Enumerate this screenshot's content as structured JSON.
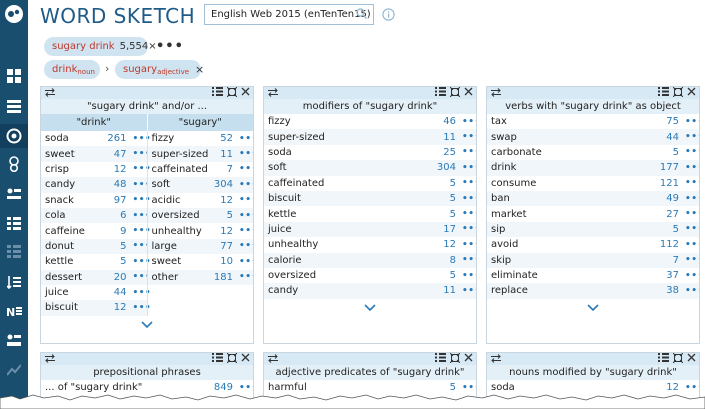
{
  "app": {
    "title": "WORD SKETCH"
  },
  "corpus": {
    "value": "English Web 2015 (enTenTen15)"
  },
  "query": {
    "text": "sugary drink",
    "count": "5,554×",
    "more": "•••"
  },
  "breadcrumb": {
    "lemma1": "drink",
    "pos1": "noun",
    "sep": "›",
    "lemma2": "sugary",
    "pos2": "adjective",
    "close": "×"
  },
  "panels": {
    "andor": {
      "title": "\"sugary drink\" and/or ...",
      "col1": "\"drink\"",
      "col2": "\"sugary\"",
      "left": [
        {
          "w": "soda",
          "n": "261"
        },
        {
          "w": "sweet",
          "n": "47"
        },
        {
          "w": "crisp",
          "n": "12"
        },
        {
          "w": "candy",
          "n": "48"
        },
        {
          "w": "snack",
          "n": "97"
        },
        {
          "w": "cola",
          "n": "6"
        },
        {
          "w": "caffeine",
          "n": "9"
        },
        {
          "w": "donut",
          "n": "5"
        },
        {
          "w": "kettle",
          "n": "5"
        },
        {
          "w": "dessert",
          "n": "20"
        },
        {
          "w": "juice",
          "n": "44"
        },
        {
          "w": "biscuit",
          "n": "12"
        }
      ],
      "right": [
        {
          "w": "fizzy",
          "n": "52"
        },
        {
          "w": "super-sized",
          "n": "11"
        },
        {
          "w": "caffeinated",
          "n": "7"
        },
        {
          "w": "soft",
          "n": "304"
        },
        {
          "w": "acidic",
          "n": "12"
        },
        {
          "w": "oversized",
          "n": "5"
        },
        {
          "w": "unhealthy",
          "n": "12"
        },
        {
          "w": "large",
          "n": "77"
        },
        {
          "w": "sweet",
          "n": "10"
        },
        {
          "w": "other",
          "n": "181"
        }
      ]
    },
    "modifiers": {
      "title": "modifiers of \"sugary drink\"",
      "rows": [
        {
          "w": "fizzy",
          "n": "46"
        },
        {
          "w": "super-sized",
          "n": "11"
        },
        {
          "w": "soda",
          "n": "25"
        },
        {
          "w": "soft",
          "n": "304"
        },
        {
          "w": "caffeinated",
          "n": "5"
        },
        {
          "w": "biscuit",
          "n": "5"
        },
        {
          "w": "kettle",
          "n": "5"
        },
        {
          "w": "juice",
          "n": "17"
        },
        {
          "w": "unhealthy",
          "n": "12"
        },
        {
          "w": "calorie",
          "n": "8"
        },
        {
          "w": "oversized",
          "n": "5"
        },
        {
          "w": "candy",
          "n": "11"
        }
      ]
    },
    "verbs": {
      "title": "verbs with \"sugary drink\" as object",
      "rows": [
        {
          "w": "tax",
          "n": "75"
        },
        {
          "w": "swap",
          "n": "44"
        },
        {
          "w": "carbonate",
          "n": "5"
        },
        {
          "w": "drink",
          "n": "177"
        },
        {
          "w": "consume",
          "n": "121"
        },
        {
          "w": "ban",
          "n": "49"
        },
        {
          "w": "market",
          "n": "27"
        },
        {
          "w": "sip",
          "n": "5"
        },
        {
          "w": "avoid",
          "n": "112"
        },
        {
          "w": "skip",
          "n": "7"
        },
        {
          "w": "eliminate",
          "n": "37"
        },
        {
          "w": "replace",
          "n": "38"
        }
      ]
    },
    "prep": {
      "title": "prepositional phrases",
      "rows": [
        {
          "w": "... of \"sugary drink\"",
          "n": "849"
        }
      ]
    },
    "adjpred": {
      "title": "adjective predicates of \"sugary drink\"",
      "rows": [
        {
          "w": "harmful",
          "n": "5"
        }
      ]
    },
    "nouns": {
      "title": "nouns modified by \"sugary drink\"",
      "rows": [
        {
          "w": "soda",
          "n": "12"
        }
      ]
    }
  },
  "colors": {
    "sidebar": "#1a4e6e",
    "accent": "#1e5b88",
    "number": "#2a7ab8",
    "chip": "#cfe3f0",
    "red": "#c0392b"
  }
}
